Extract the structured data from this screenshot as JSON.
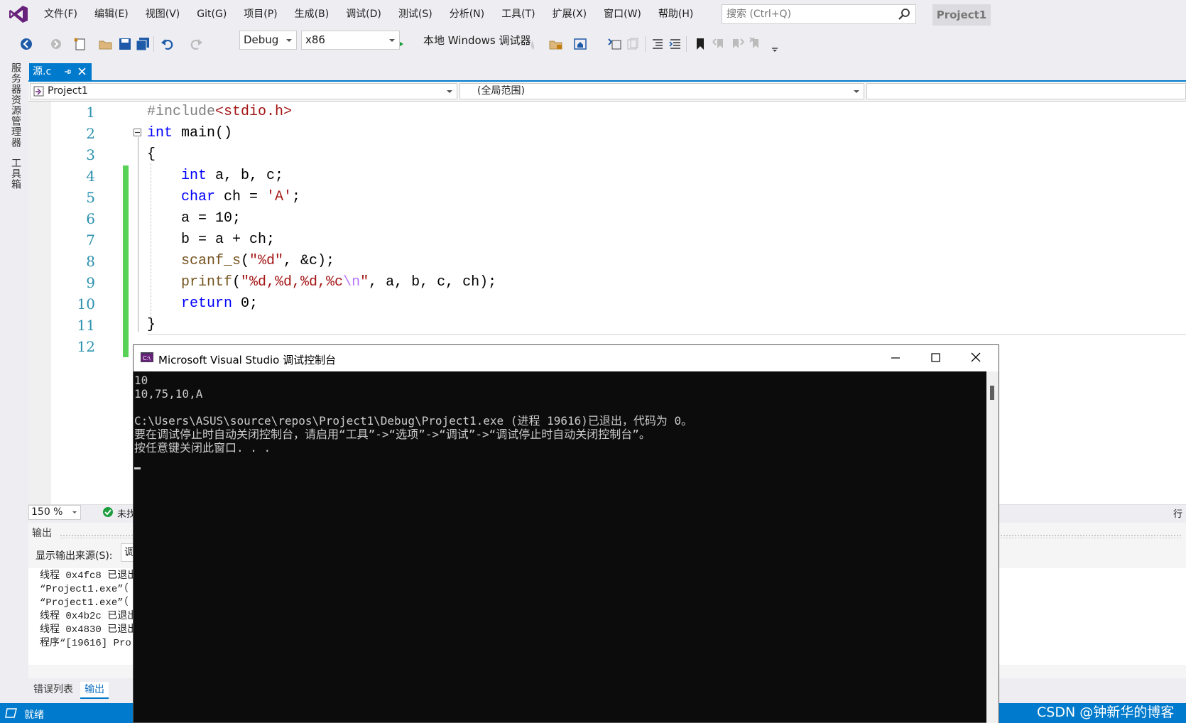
{
  "app": {
    "menu": [
      "文件(F)",
      "编辑(E)",
      "视图(V)",
      "Git(G)",
      "项目(P)",
      "生成(B)",
      "调试(D)",
      "测试(S)",
      "分析(N)",
      "工具(T)",
      "扩展(X)",
      "窗口(W)",
      "帮助(H)"
    ],
    "search_placeholder": "搜索 (Ctrl+Q)",
    "project_badge": "Project1"
  },
  "toolbar": {
    "config": "Debug",
    "platform": "x86",
    "run_label": "本地 Windows 调试器",
    "accent": "#007acc"
  },
  "side_tabs": [
    "服务器资源管理器",
    "工具箱"
  ],
  "doc_tab": {
    "label": "源.c"
  },
  "navbar": {
    "project": "Project1",
    "scope": "(全局范围)"
  },
  "editor": {
    "line_numbers": [
      "1",
      "2",
      "3",
      "4",
      "5",
      "6",
      "7",
      "8",
      "9",
      "10",
      "11",
      "12"
    ],
    "code": {
      "l1_pp": "#include",
      "l1_hdr": "<stdio.h>",
      "l2_kw": "int",
      "l2_rest": " main()",
      "l3": "{",
      "l4_kw": "int",
      "l4_rest": " a, b, c;",
      "l5_kw": "char",
      "l5_mid": " ch = ",
      "l5_str": "'A'",
      "l5_end": ";",
      "l6": "a = 10;",
      "l7": "b = a + ch;",
      "l8_fn": "scanf_s",
      "l8_open": "(",
      "l8_str": "\"%d\"",
      "l8_rest": ", &c);",
      "l9_fn": "printf",
      "l9_open": "(",
      "l9_str": "\"%d,%d,%d,%c",
      "l9_esc": "\\n",
      "l9_strend": "\"",
      "l9_rest": ", a, b, c, ch);",
      "l10_kw": "return",
      "l10_rest": " 0;",
      "l11": "}"
    },
    "zoom": "150 %",
    "status_partial": "未找",
    "status_right": "行"
  },
  "output": {
    "title": "输出",
    "source_label": "显示输出来源(S):",
    "source_value": "调",
    "lines": [
      "线程 0x4fc8 已退出",
      "“Project1.exe”（",
      "“Project1.exe”（",
      "线程 0x4b2c 已退出",
      "线程 0x4830 已退出",
      "程序“[19616] Pro"
    ]
  },
  "bottom_tabs": {
    "errors": "错误列表",
    "output": "输出"
  },
  "status": {
    "text": "就绪"
  },
  "watermark": "CSDN @钟新华的博客",
  "console": {
    "title": "Microsoft Visual Studio 调试控制台",
    "lines": [
      "10",
      "10,75,10,A",
      "",
      "C:\\Users\\ASUS\\source\\repos\\Project1\\Debug\\Project1.exe (进程 19616)已退出，代码为 0。",
      "要在调试停止时自动关闭控制台，请启用“工具”->“选项”->“调试”->“调试停止时自动关闭控制台”。",
      "按任意键关闭此窗口. . ."
    ]
  }
}
